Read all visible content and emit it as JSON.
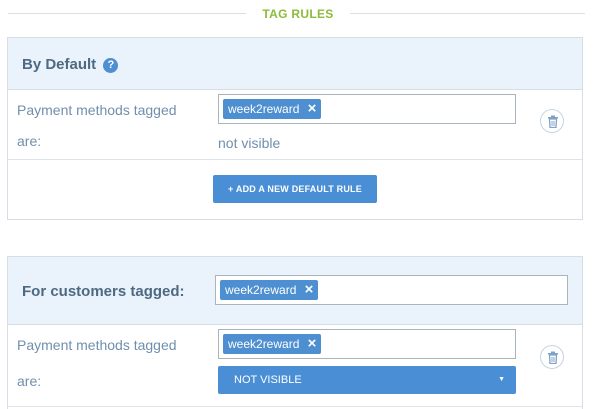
{
  "section": {
    "title": "TAG RULES"
  },
  "default_panel": {
    "title": "By Default",
    "help_icon": "question-circle-icon",
    "rule": {
      "label_line1": "Payment methods tagged",
      "label_line2": "are:",
      "tag": "week2reward",
      "tag_remove": "×",
      "visibility": "not visible"
    },
    "add_button": "+ ADD A NEW DEFAULT RULE"
  },
  "customer_panel": {
    "title": "For customers tagged:",
    "customer_tag": "week2reward",
    "tag_remove": "×",
    "rule": {
      "label_line1": "Payment methods tagged",
      "label_line2": "are:",
      "tag": "week2reward",
      "tag_remove": "×",
      "visibility_select": "NOT VISIBLE",
      "select_caret": "▼"
    }
  },
  "colors": {
    "accent": "#4a8fd6",
    "section_title": "#8dbb3b",
    "panel_head": "#eaf2fb"
  },
  "icons": {
    "delete": "trash-icon"
  }
}
